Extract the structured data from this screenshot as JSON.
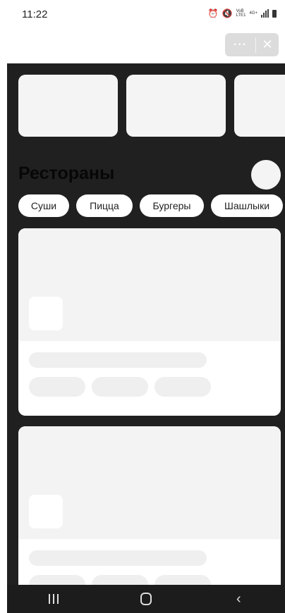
{
  "status_bar": {
    "time": "11:22",
    "icons": [
      "alarm-icon",
      "mute-icon",
      "volte-icon",
      "4g-icon",
      "signal-icon",
      "battery-icon"
    ],
    "volte_text": "VoB",
    "lte_text": "LTE1",
    "network_text": "4G+"
  },
  "capsule": {
    "more_label": "···",
    "close_label": "✕"
  },
  "restaurants": {
    "title": "Рестораны",
    "categories": [
      "Суши",
      "Пицца",
      "Бургеры",
      "Шашлыки"
    ]
  },
  "nav": {
    "back_label": "‹"
  },
  "colors": {
    "content_bg": "#202020",
    "card_bg": "#ffffff",
    "skeleton": "#efefef",
    "capsule_bg": "#dcdcdc"
  }
}
